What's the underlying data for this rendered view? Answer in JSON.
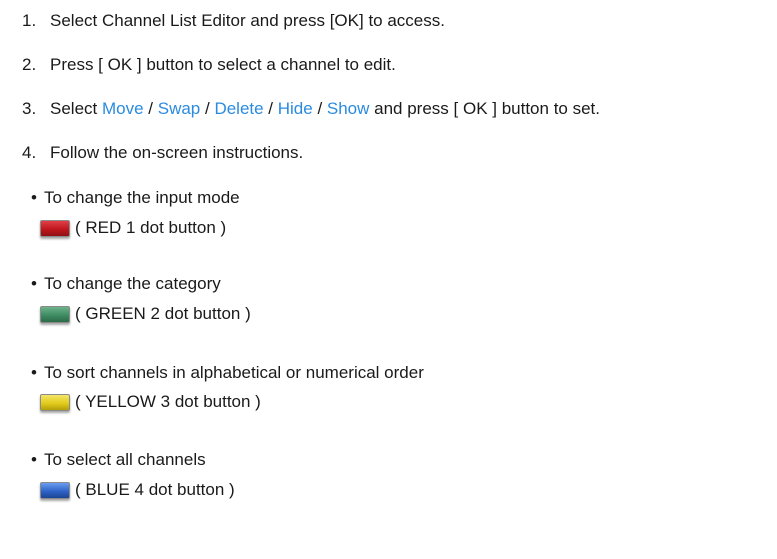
{
  "steps": [
    {
      "num": "1.",
      "text": "Select Channel List Editor and press [OK] to access."
    },
    {
      "num": "2.",
      "text": "Press [ OK ] button to select a channel to edit."
    },
    {
      "num": "3.",
      "before": "Select ",
      "options": [
        "Move",
        "Swap",
        "Delete",
        "Hide",
        "Show"
      ],
      "separator": " / ",
      "after": " and press [ OK ] button to set."
    },
    {
      "num": "4.",
      "text": "Follow the on-screen instructions."
    }
  ],
  "bullet_symbol": "•",
  "bullets": [
    {
      "text": "To change the input mode",
      "button_label": "( RED 1 dot button )",
      "button_color": "#c0161e",
      "button_icon": "red-button-icon"
    },
    {
      "text": "To change the category",
      "button_label": "( GREEN 2 dot button )",
      "button_color": "#3f8b62",
      "button_icon": "green-button-icon"
    },
    {
      "text": "To sort channels in alphabetical or numerical order",
      "button_label": "( YELLOW 3 dot button )",
      "button_color": "#e2cc1a",
      "button_icon": "yellow-button-icon"
    },
    {
      "text": "To select all channels",
      "button_label": "( BLUE 4 dot button )",
      "button_color": "#2e63c8",
      "button_icon": "blue-button-icon"
    }
  ],
  "colors": {
    "link": "#2a8be0",
    "text": "#1a1a1a",
    "background": "#ffffff"
  }
}
